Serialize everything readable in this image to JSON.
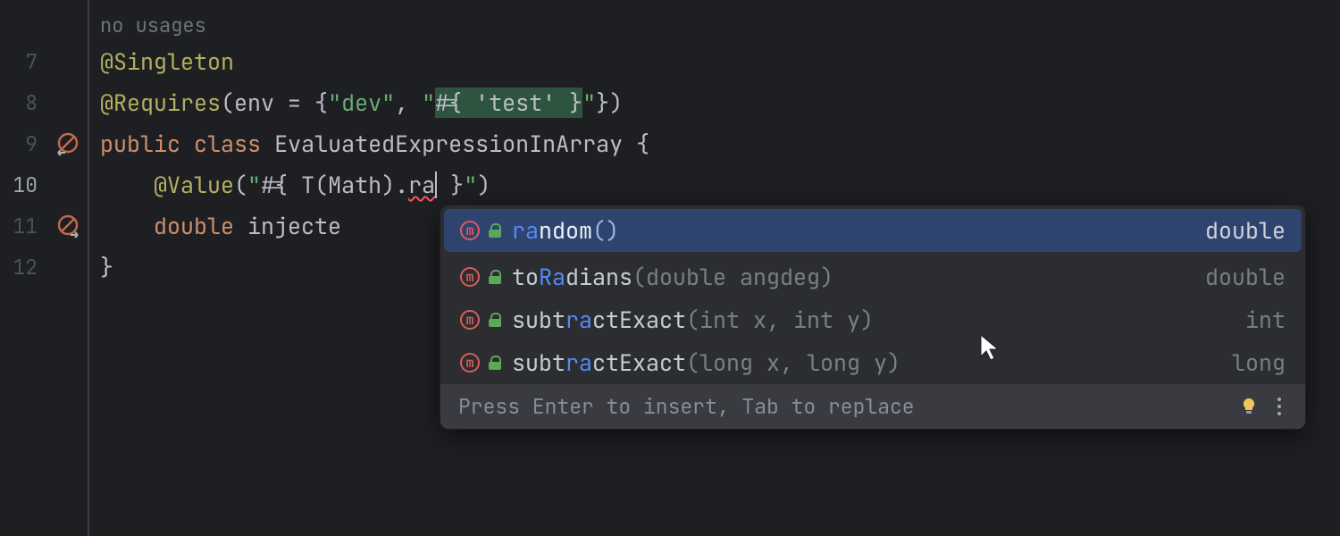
{
  "usages_hint": "no usages",
  "lines": {
    "l7": {
      "num": "7",
      "ann": "@Singleton"
    },
    "l8": {
      "num": "8",
      "ann": "@Requires",
      "lp": "(",
      "env": "env",
      "eq": " = ",
      "ob": "{",
      "s1": "\"dev\"",
      "comma": ", ",
      "s2a": "\"",
      "s2hl": "#{ 'test' }",
      "s2b": "\"",
      "cb": "}",
      "rp": ")"
    },
    "l9": {
      "num": "9",
      "kw1": "public",
      "sp1": " ",
      "kw2": "class",
      "sp2": " ",
      "name": "EvaluatedExpressionInArray",
      "sp3": " ",
      "ob": "{"
    },
    "l10": {
      "num": "10",
      "indent": "    ",
      "ann": "@Value",
      "lp": "(",
      "q1": "\"",
      "open": "#{ ",
      "tfn": "T",
      "tlp": "(",
      "targ": "Math",
      "trp": ")",
      "dot": ".",
      "typed": "ra",
      "close": " }",
      "q2": "\"",
      "rp": ")"
    },
    "l11": {
      "num": "11",
      "indent": "    ",
      "kw": "double",
      "sp": " ",
      "name": "injecte"
    },
    "l12": {
      "num": "12",
      "cb": "}"
    }
  },
  "popup": {
    "hint": "Press Enter to insert, Tab to replace",
    "items": [
      {
        "match": "ra",
        "rest": "ndom",
        "params": "()",
        "type": "double",
        "selected": true
      },
      {
        "match1": "to",
        "match2": "Ra",
        "rest": "dians",
        "params": "(double angdeg)",
        "type": "double",
        "selected": false
      },
      {
        "match1": "subt",
        "match2": "ra",
        "rest": "ctExact",
        "params": "(int x, int y)",
        "type": "int",
        "selected": false
      },
      {
        "match1": "subt",
        "match2": "ra",
        "rest": "ctExact",
        "params": "(long x, long y)",
        "type": "long",
        "selected": false
      }
    ]
  }
}
